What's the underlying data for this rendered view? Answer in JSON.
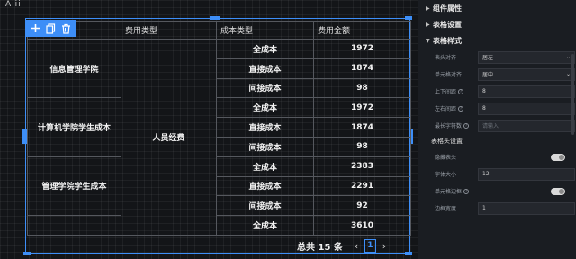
{
  "canvas": {
    "top_mark": "Aiii",
    "toolbar": {
      "add_icon": "plus-icon",
      "copy_icon": "copy-icon",
      "delete_icon": "trash-icon"
    }
  },
  "table": {
    "headers": [
      "",
      "费用类型",
      "成本类型",
      "费用金额"
    ],
    "groups": [
      {
        "name": "信息管理学院",
        "rows": [
          {
            "type": "全成本",
            "amount": "1972"
          },
          {
            "type": "直接成本",
            "amount": "1874"
          },
          {
            "type": "间接成本",
            "amount": "98"
          }
        ]
      },
      {
        "name": "计算机学院学生成本",
        "rows": [
          {
            "type": "全成本",
            "amount": "1972"
          },
          {
            "type": "直接成本",
            "amount": "1874"
          },
          {
            "type": "间接成本",
            "amount": "98"
          }
        ]
      },
      {
        "name": "管理学院学生成本",
        "rows": [
          {
            "type": "全成本",
            "amount": "2383"
          },
          {
            "type": "直接成本",
            "amount": "2291"
          },
          {
            "type": "间接成本",
            "amount": "92"
          }
        ]
      },
      {
        "name": "",
        "rows": [
          {
            "type": "全成本",
            "amount": "3610"
          }
        ]
      }
    ],
    "fee_type": "人员经费",
    "footer": {
      "total": "总共 15 条",
      "prev": "‹",
      "page": "1",
      "next": "›"
    }
  },
  "panel": {
    "sections": {
      "component_attr": "组件属性",
      "table_settings": "表格设置",
      "table_style": "表格样式"
    },
    "rows": [
      {
        "label": "表头对齐",
        "value": "居左",
        "placeholder": false
      },
      {
        "label": "单元格对齐",
        "value": "居中",
        "placeholder": false
      },
      {
        "label": "上下间距",
        "value": "8",
        "placeholder": false
      },
      {
        "label": "左右间距",
        "value": "8",
        "placeholder": false
      },
      {
        "label": "最长字符数",
        "value": "请输入",
        "placeholder": true
      }
    ],
    "header_settings": "表格头设置",
    "hide_header": "隐藏表头",
    "font_size_label": "字体大小",
    "font_size_value": "12",
    "cell_border_label": "单元格边框",
    "border_width_label": "边框宽度",
    "border_width_value": "1"
  }
}
